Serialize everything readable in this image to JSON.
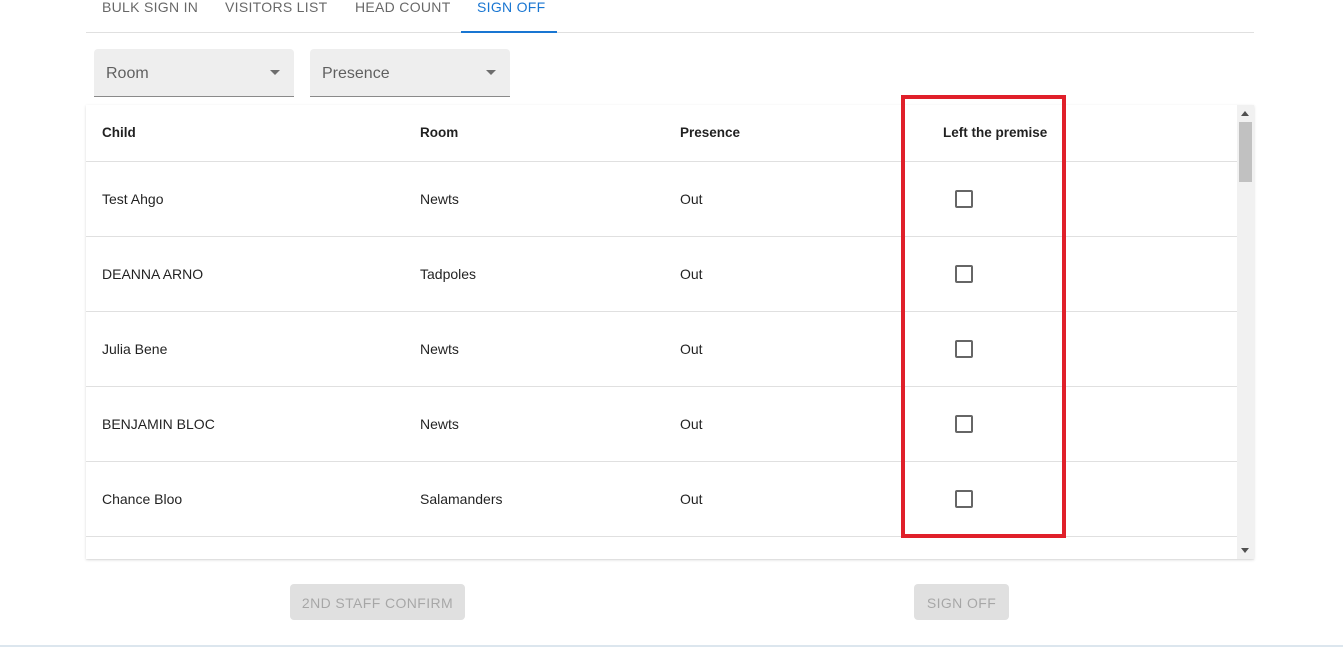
{
  "tabs": [
    {
      "label": "BULK SIGN IN",
      "active": false
    },
    {
      "label": "VISITORS LIST",
      "active": false
    },
    {
      "label": "HEAD COUNT",
      "active": false
    },
    {
      "label": "SIGN OFF",
      "active": true
    }
  ],
  "filters": {
    "room": {
      "label": "Room",
      "icon": "dropdown-arrow-icon"
    },
    "presence": {
      "label": "Presence",
      "icon": "dropdown-arrow-icon"
    }
  },
  "table": {
    "columns": [
      "Child",
      "Room",
      "Presence",
      "Left the premise"
    ],
    "rows": [
      {
        "child": "Test Ahgo",
        "room": "Newts",
        "presence": "Out",
        "left": false
      },
      {
        "child": "DEANNA ARNO",
        "room": "Tadpoles",
        "presence": "Out",
        "left": false
      },
      {
        "child": "Julia Bene",
        "room": "Newts",
        "presence": "Out",
        "left": false
      },
      {
        "child": "BENJAMIN BLOC",
        "room": "Newts",
        "presence": "Out",
        "left": false
      },
      {
        "child": "Chance Bloo",
        "room": "Salamanders",
        "presence": "Out",
        "left": false
      }
    ]
  },
  "buttons": {
    "staff_confirm": "2ND STAFF CONFIRM",
    "sign_off": "SIGN OFF"
  },
  "colors": {
    "accent": "#1976d2",
    "highlight": "#e0202a",
    "disabled_bg": "#e0e0e0"
  }
}
